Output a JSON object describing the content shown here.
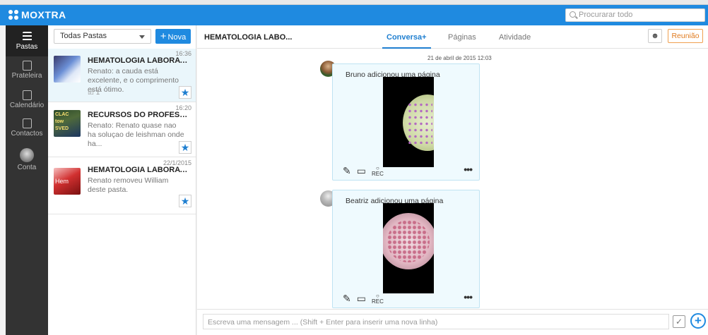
{
  "app": {
    "logo_text": "MOXTRA"
  },
  "search": {
    "placeholder": "Procurarar todo"
  },
  "sidebar": {
    "items": [
      {
        "label": "Pastas",
        "icon": "list-icon"
      },
      {
        "label": "Prateleira",
        "icon": "shelf-icon"
      },
      {
        "label": "Calendário",
        "icon": "calendar-icon"
      },
      {
        "label": "Contactos",
        "icon": "contacts-icon"
      },
      {
        "label": "Conta",
        "icon": "avatar"
      }
    ]
  },
  "leftpanel": {
    "folder_select": "Todas Pastas",
    "new_button": "Nova",
    "new_button_plus": "+",
    "conversations": [
      {
        "title": "HEMATOLOGIA LABORATORI...",
        "preview": "Renato: a cauda está excelente, e o comprimento está ótimo.",
        "time": "16:36",
        "tasks": "1",
        "starred": true
      },
      {
        "title": "RECURSOS DO PROFESSOR",
        "preview": "Renato: Renato quase nao ha soluçao de leishman onde ha...",
        "time": "16:20",
        "starred": true
      },
      {
        "title": "HEMATOLOGIA LABORATORI...",
        "preview": "Renato removeu William deste pasta.",
        "time": "22/1/2015",
        "starred": true,
        "thumb_text": "Hem"
      }
    ],
    "thumb2_words": [
      "CLAC",
      "tow",
      "SVED"
    ]
  },
  "main": {
    "title": "HEMATOLOGIA LABO...",
    "tabs": [
      "Conversa+",
      "Páginas",
      "Atividade"
    ],
    "meeting_button": "Reunião",
    "people_icon": "people-settings-icon"
  },
  "feed": {
    "date": "21 de abril de 2015 12:03",
    "posts": [
      {
        "text": "Bruno adicionou uma página",
        "rec": "REC"
      },
      {
        "text": "Beatriz adicionou uma página",
        "rec": "REC"
      }
    ]
  },
  "composer": {
    "placeholder": "Escreva uma mensagem ... (Shift + Enter para inserir uma nova linha)"
  },
  "colors": {
    "accent": "#1f8ae0",
    "sidebar": "#333333",
    "meeting": "#e07b1f",
    "online": "#22b14c"
  }
}
